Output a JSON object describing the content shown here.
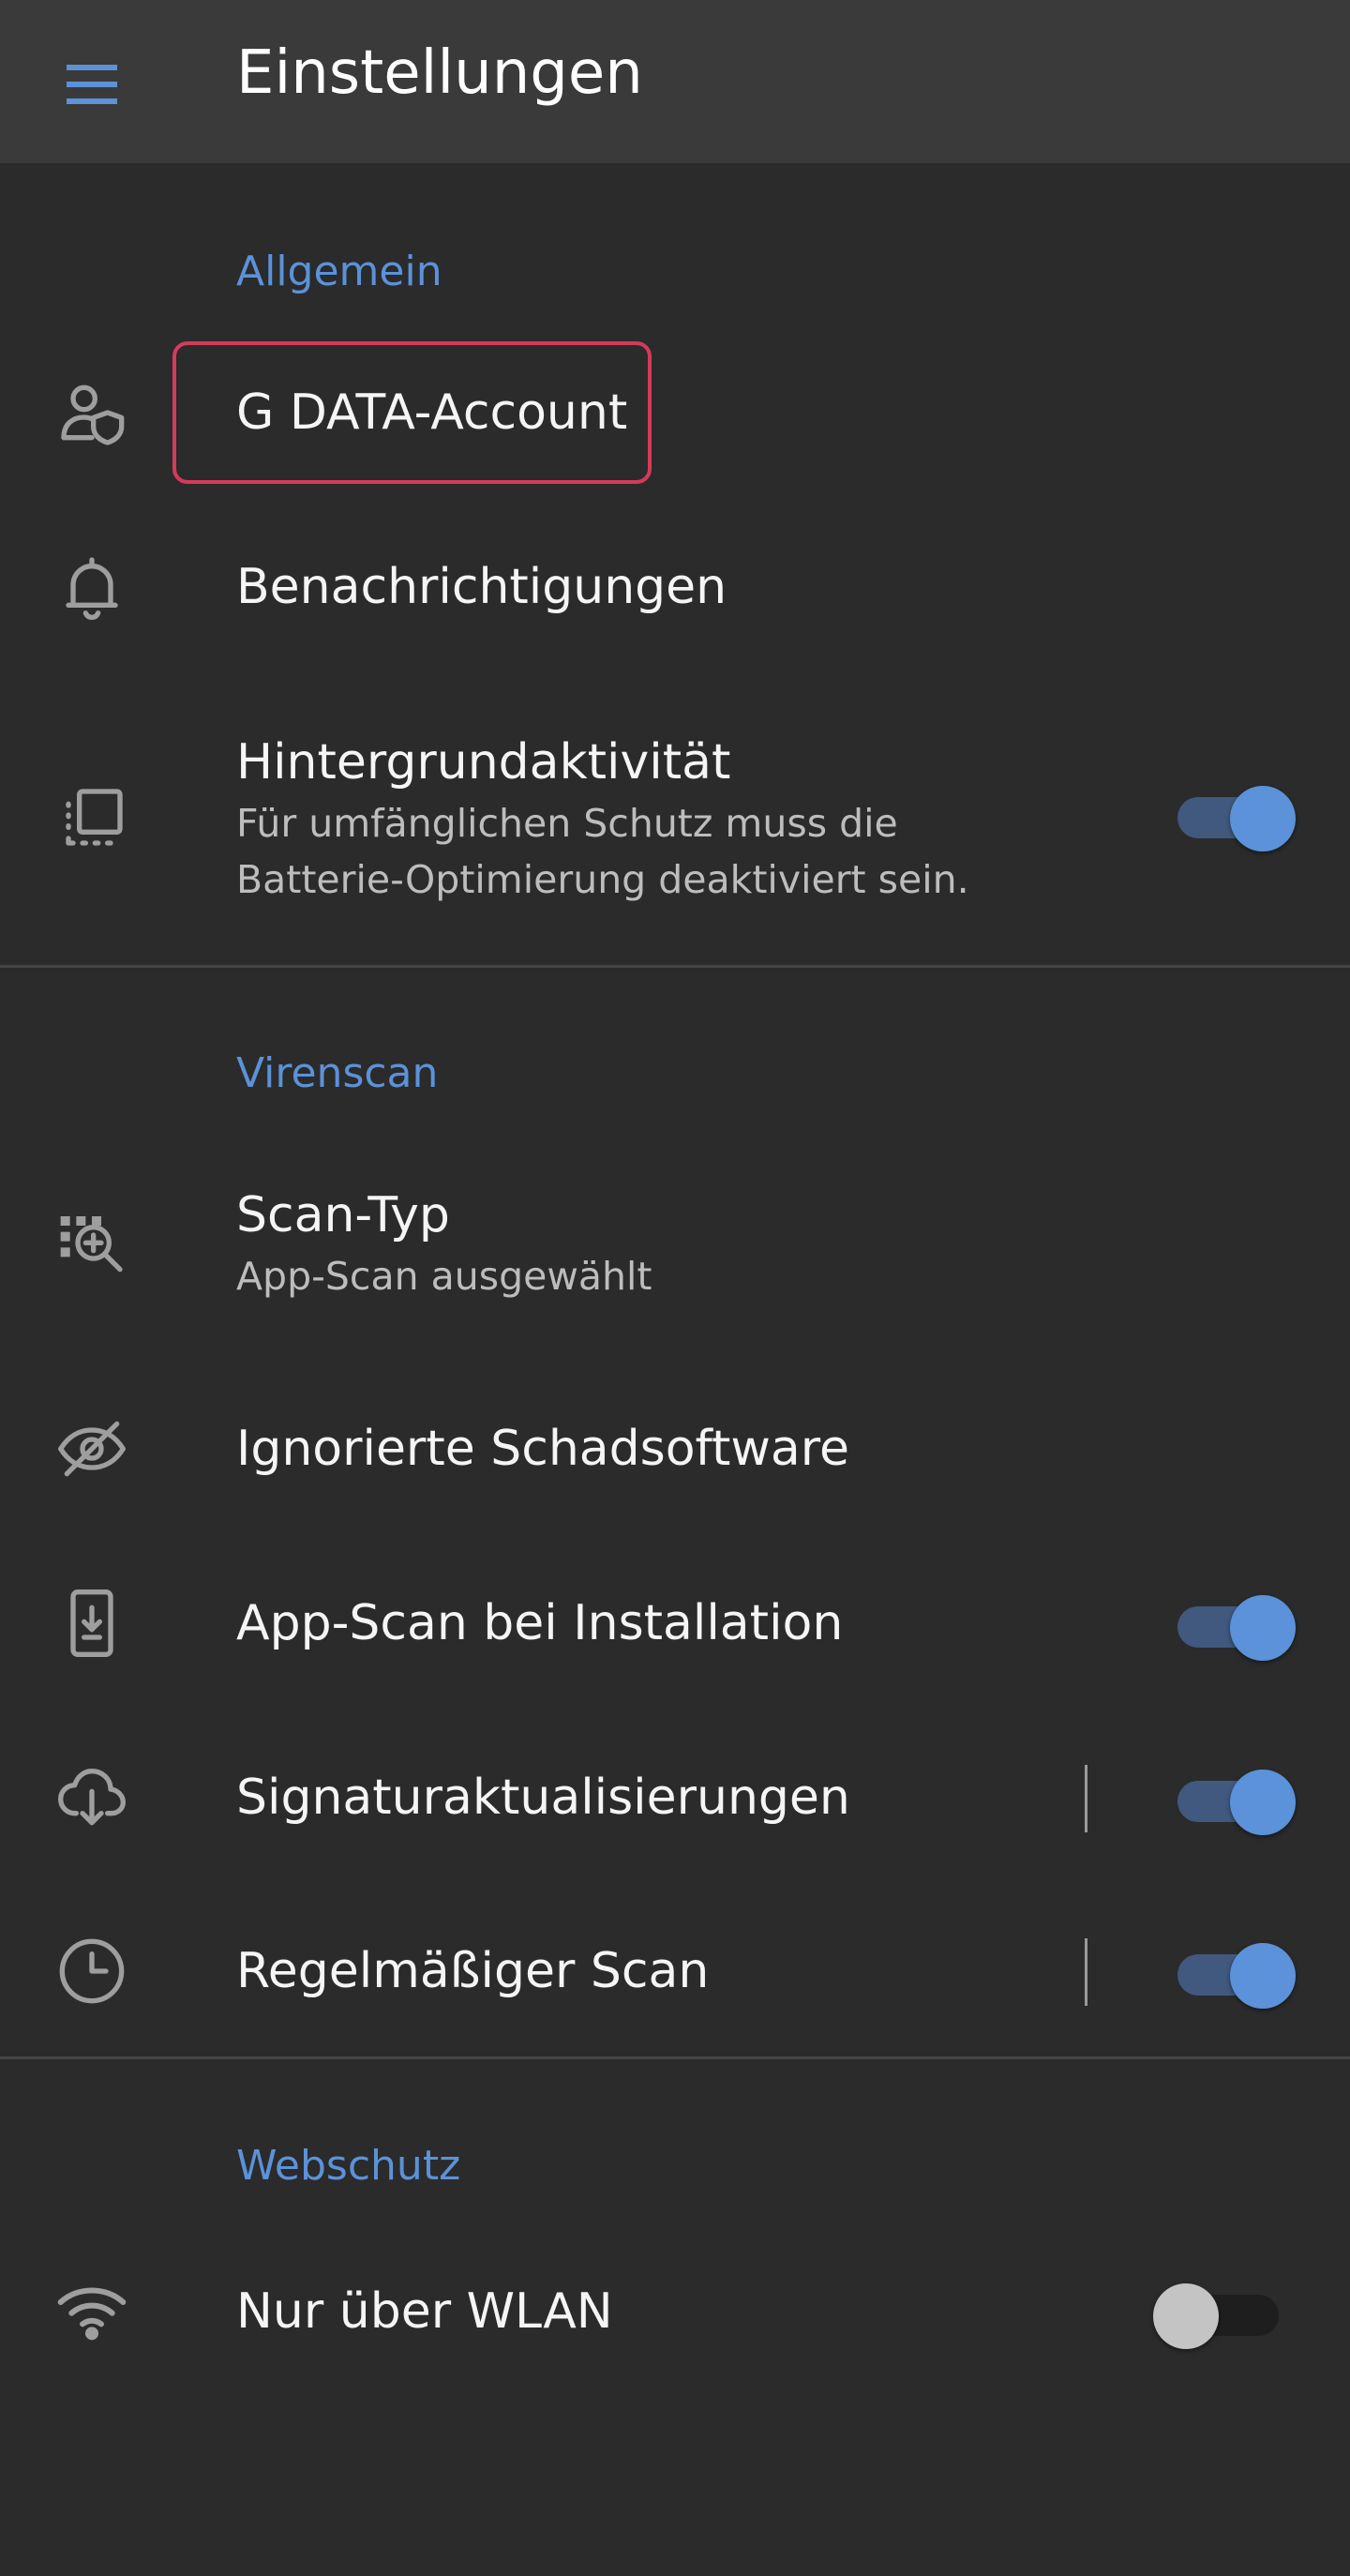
{
  "appbar": {
    "title": "Einstellungen",
    "menu_icon": "hamburger-menu-icon"
  },
  "sections": {
    "general": {
      "header": "Allgemein",
      "items": {
        "account": {
          "label": "G DATA-Account",
          "icon": "account-shield-icon"
        },
        "notifications": {
          "label": "Benachrichtigungen",
          "icon": "bell-icon"
        },
        "background": {
          "label": "Hintergrundaktivität",
          "sub_line1": "Für umfänglichen Schutz muss die",
          "sub_line2": "Batterie-Optimierung deaktiviert sein.",
          "icon": "background-activity-icon",
          "enabled": true
        }
      }
    },
    "virus_scan": {
      "header": "Virenscan",
      "items": {
        "scan_type": {
          "label": "Scan-Typ",
          "sub": "App-Scan ausgewählt",
          "icon": "scan-search-icon"
        },
        "ignored": {
          "label": "Ignorierte Schadsoftware",
          "icon": "eye-off-icon"
        },
        "install_scan": {
          "label": "App-Scan bei Installation",
          "icon": "phone-download-icon",
          "enabled": true
        },
        "signatures": {
          "label": "Signaturaktualisierungen",
          "icon": "cloud-download-icon",
          "enabled": true
        },
        "scheduled": {
          "label": "Regelmäßiger Scan",
          "icon": "clock-icon",
          "enabled": true
        }
      }
    },
    "web_protection": {
      "header": "Webschutz",
      "items": {
        "wifi_only": {
          "label": "Nur über WLAN",
          "icon": "wifi-icon",
          "enabled": false
        }
      }
    }
  },
  "colors": {
    "background": "#2b2b2b",
    "appbar": "#3a3a3a",
    "accent": "#5b92d9",
    "focus_outline": "#d63a5a",
    "icon": "#9e9e9e"
  }
}
